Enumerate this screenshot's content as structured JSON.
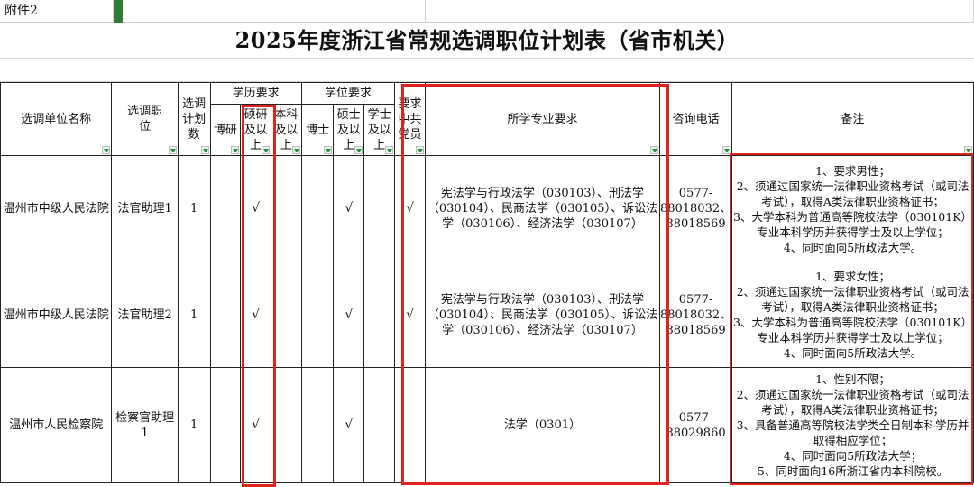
{
  "annex_label": "附件2",
  "title": "2025年度浙江省常规选调职位计划表（省市机关）",
  "headers": {
    "unit": "选调单位名称",
    "position": "选调职位",
    "plan_count": "选调计划数",
    "education_group": "学历要求",
    "edu_phd": "博研",
    "edu_master_up": "硕研及以上",
    "edu_bachelor_up": "本科及以上",
    "degree_group": "学位要求",
    "deg_phd": "博士",
    "deg_master_up": "硕士及以上",
    "deg_bachelor_up": "学士及以上",
    "party": "要求中共党员",
    "major": "所学专业要求",
    "phone": "咨询电话",
    "notes": "备注"
  },
  "rows": [
    {
      "unit": "温州市中级人民法院",
      "position": "法官助理1",
      "count": "1",
      "edu_master": "√",
      "deg_master": "√",
      "party": "√",
      "major": "宪法学与行政法学（030103）、刑法学（030104）、民商法学（030105）、诉讼法学（030106）、经济法学（030107）",
      "phone": "0577-88018032、88018569",
      "notes": [
        "1、要求男性；",
        "2、须通过国家统一法律职业资格考试（或司法考试），取得A类法律职业资格证书；",
        "3、大学本科为普通高等院校法学（030101K）专业本科学历并获得学士及以上学位；",
        "4、同时面向5所政法大学。"
      ]
    },
    {
      "unit": "温州市中级人民法院",
      "position": "法官助理2",
      "count": "1",
      "edu_master": "√",
      "deg_master": "√",
      "party": "√",
      "major": "宪法学与行政法学（030103）、刑法学（030104）、民商法学（030105）、诉讼法学（030106）、经济法学（030107）",
      "phone": "0577-88018032、88018569",
      "notes": [
        "1、要求女性；",
        "2、须通过国家统一法律职业资格考试（或司法考试），取得A类法律职业资格证书；",
        "3、大学本科为普通高等院校法学（030101K）专业本科学历并获得学士及以上学位；",
        "4、同时面向5所政法大学。"
      ]
    },
    {
      "unit": "温州市人民检察院",
      "position": "检察官助理1",
      "count": "1",
      "edu_master": "√",
      "deg_master": "√",
      "party": "",
      "major": "法学（0301）",
      "phone": "0577-88029860",
      "notes": [
        "1、性别不限；",
        "2、须通过国家统一法律职业资格考试（或司法考试），取得A类法律职业资格证书；",
        "3、具备普通高等院校法学类全日制本科学历并取得相应学位；",
        "4、同时面向5所政法大学；",
        "5、同时面向16所浙江省内本科院校。"
      ]
    }
  ],
  "colors": {
    "highlight_box": "#e0231e",
    "grid": "#222222",
    "filter_arrow": "#1a8f3e"
  }
}
